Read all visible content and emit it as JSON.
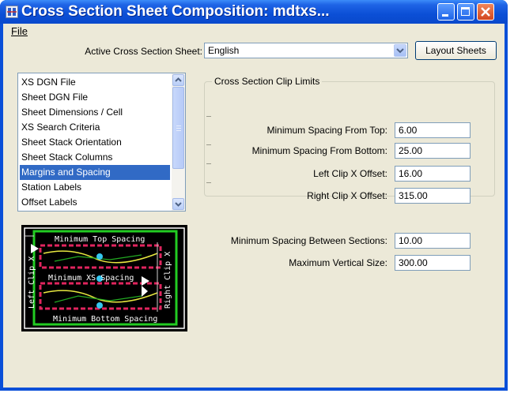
{
  "window": {
    "title": "Cross Section Sheet Composition: mdtxs..."
  },
  "menu": {
    "file": "File"
  },
  "active_sheet": {
    "label": "Active Cross Section Sheet:",
    "value": "English"
  },
  "layout_button": "Layout Sheets",
  "list": {
    "items": [
      "XS DGN File",
      "Sheet DGN File",
      "Sheet Dimensions / Cell",
      "XS Search Criteria",
      "Sheet Stack Orientation",
      "Sheet Stack Columns",
      "Margins and Spacing",
      "Station Labels",
      "Offset Labels"
    ],
    "selected_index": 6
  },
  "clip_limits": {
    "title": "Cross Section Clip Limits",
    "fields": [
      {
        "label": "Minimum Spacing From Top:",
        "value": "6.00"
      },
      {
        "label": "Minimum Spacing From Bottom:",
        "value": "25.00"
      },
      {
        "label": "Left Clip X Offset:",
        "value": "16.00"
      },
      {
        "label": "Right Clip X Offset:",
        "value": "315.00"
      }
    ]
  },
  "spacing": {
    "between_label": "Minimum Spacing Between Sections:",
    "between_value": "10.00",
    "vertical_label": "Maximum Vertical Size:",
    "vertical_value": "300.00"
  },
  "preview": {
    "top_label": "Minimum Top Spacing",
    "middle_label": "Minimum XS Spacing",
    "bottom_label": "Minimum Bottom Spacing",
    "left_label": "Left Clip X",
    "right_label": "Right Clip X"
  },
  "colors": {
    "title_blue": "#0a4fd8",
    "selection": "#316ac5",
    "close_red": "#d2461f",
    "dialog_bg": "#ece9d8"
  }
}
